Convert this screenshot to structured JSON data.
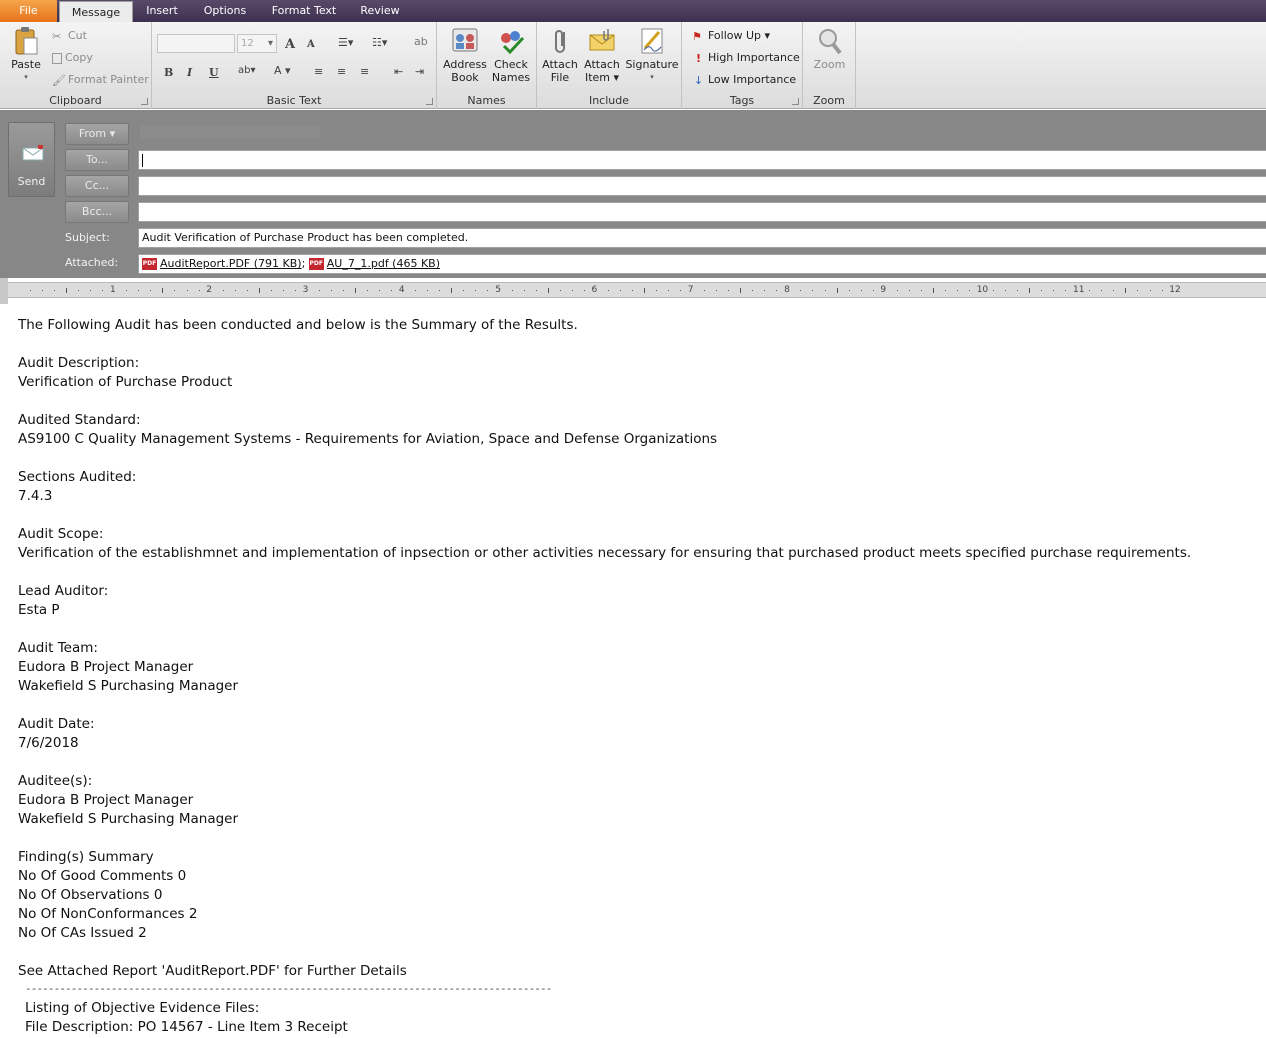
{
  "tabs": {
    "file": "File",
    "message": "Message",
    "insert": "Insert",
    "options": "Options",
    "format_text": "Format Text",
    "review": "Review"
  },
  "ribbon": {
    "clipboard": {
      "paste": "Paste",
      "cut": "Cut",
      "copy": "Copy",
      "format_painter": "Format Painter",
      "label": "Clipboard"
    },
    "basic_text": {
      "font_size": "12",
      "label": "Basic Text"
    },
    "names": {
      "address_book_1": "Address",
      "address_book_2": "Book",
      "check_names_1": "Check",
      "check_names_2": "Names",
      "label": "Names"
    },
    "include": {
      "attach_file_1": "Attach",
      "attach_file_2": "File",
      "attach_item_1": "Attach",
      "attach_item_2": "Item ▾",
      "signature": "Signature",
      "label": "Include"
    },
    "tags": {
      "follow_up": "Follow Up ▾",
      "high_importance": "High Importance",
      "low_importance": "Low Importance",
      "label": "Tags"
    },
    "zoom": {
      "zoom": "Zoom",
      "label": "Zoom"
    }
  },
  "header": {
    "send": "Send",
    "from": "From ▾",
    "to": "To...",
    "cc": "Cc...",
    "bcc": "Bcc...",
    "subject_label": "Subject:",
    "subject_value": "Audit Verification of Purchase Product has been completed.",
    "attached_label": "Attached:",
    "attachments": [
      {
        "icon": "pdf-icon",
        "name": "AuditReport.PDF (791 KB)"
      },
      {
        "icon": "pdf-icon",
        "name": "AU_7_1.pdf (465 KB)"
      }
    ]
  },
  "ruler": {
    "numbers": [
      "1",
      "2",
      "3",
      "4",
      "5",
      "6",
      "7",
      "8",
      "9",
      "10",
      "11",
      "12",
      "1"
    ]
  },
  "body": {
    "lines": [
      "The Following Audit has been conducted and below is the Summary of the Results.",
      "",
      "Audit Description:",
      "Verification of Purchase Product",
      "",
      "Audited Standard:",
      "AS9100 C Quality Management Systems - Requirements for Aviation, Space and Defense Organizations",
      "",
      "Sections Audited:",
      "7.4.3",
      "",
      "Audit Scope:",
      "Verification of the establishmnet and implementation of inpsection or other activities necessary for ensuring that purchased product meets specified purchase requirements.",
      "",
      "Lead Auditor:",
      "Esta P",
      "",
      "Audit Team:",
      "Eudora B Project Manager",
      "Wakefield S Purchasing Manager",
      "",
      "Audit Date:",
      "7/6/2018",
      "",
      "Auditee(s):",
      "Eudora B Project Manager",
      "Wakefield S Purchasing Manager",
      "",
      "Finding(s) Summary",
      "No Of Good Comments 0",
      "No Of Observations 0",
      "No Of NonConformances 2",
      "No Of CAs Issued 2",
      "",
      "See Attached Report 'AuditReport.PDF' for Further Details"
    ],
    "separator": "--------------------------------------------------------------------------------------------",
    "listing_title": "Listing of Objective Evidence Files:",
    "listing_item": "File Description: PO 14567 - Line Item 3 Receipt"
  },
  "colors": {
    "file_tab": "#e6741c",
    "tab_bar": "#3e3050",
    "header_bg": "#878787"
  }
}
